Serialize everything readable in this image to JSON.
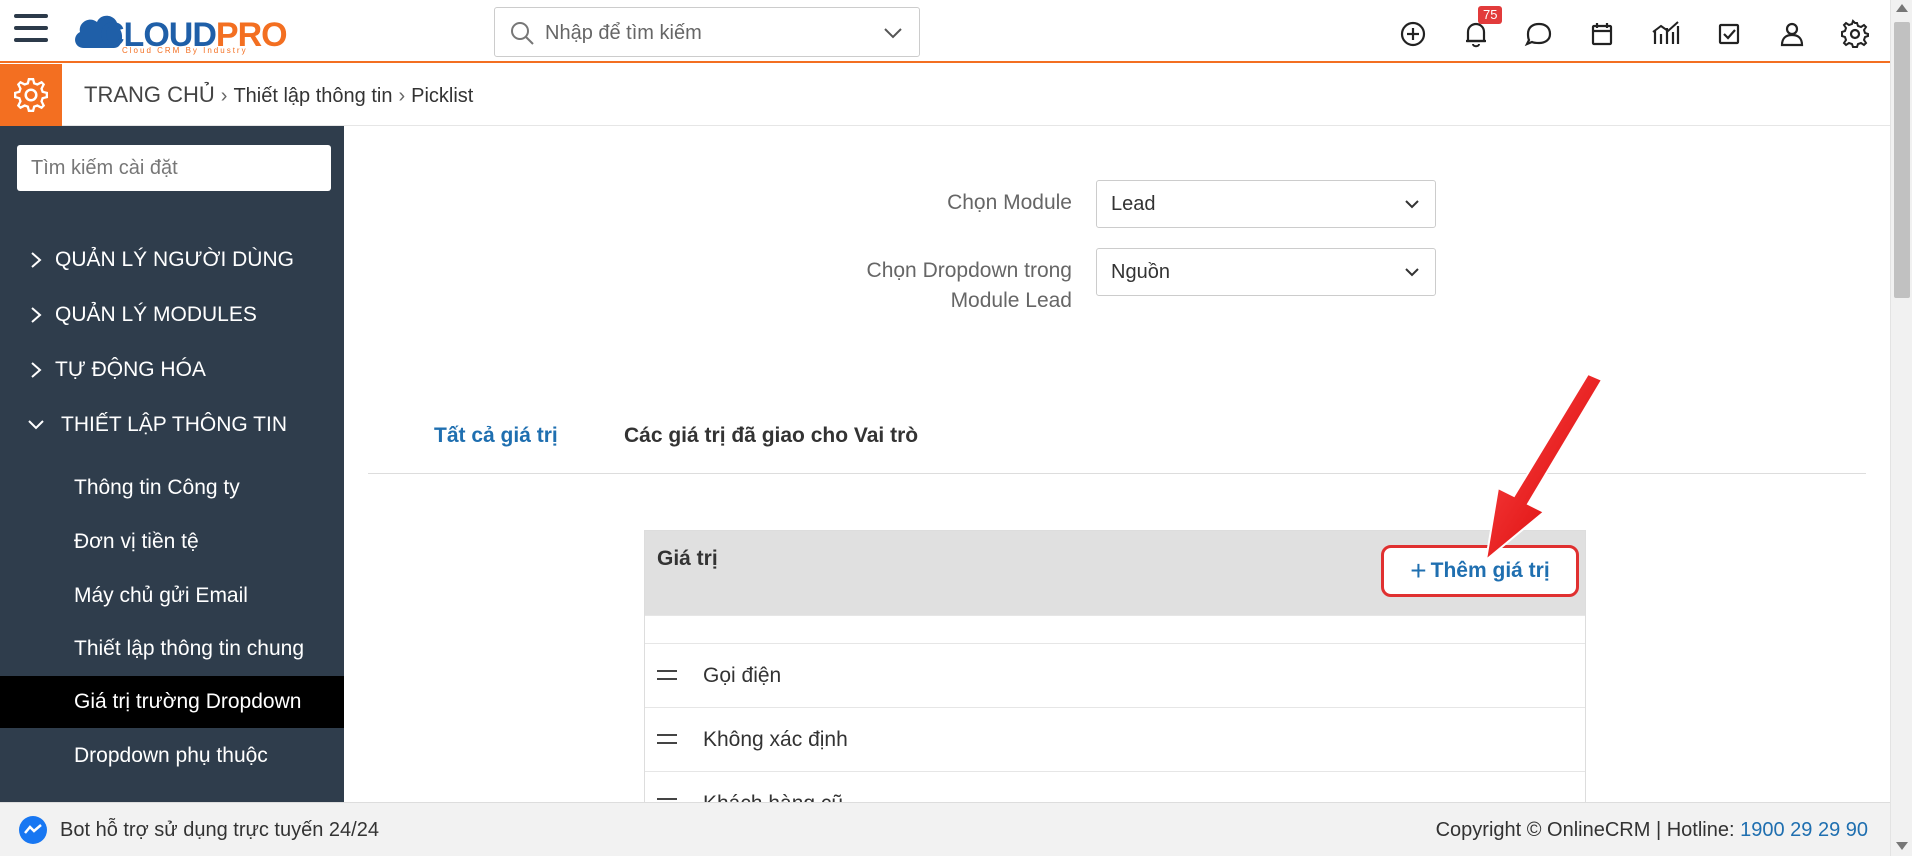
{
  "brand": {
    "logo_text_main": "CLOUD",
    "logo_text_accent": "PRO",
    "logo_tagline": "Cloud CRM By Industry",
    "accent_color": "#f36f21",
    "brand_color": "#1f5fa8"
  },
  "topbar": {
    "search_placeholder": "Nhập để tìm kiếm",
    "notification_count": "75",
    "icons": [
      "plus-circle-icon",
      "bell-icon",
      "chat-icon",
      "calendar-icon",
      "chart-icon",
      "checkbox-icon",
      "user-icon",
      "gear-icon"
    ]
  },
  "breadcrumb": {
    "home": "TRANG CHỦ",
    "level1": "Thiết lập thông tin",
    "level2": "Picklist"
  },
  "sidebar": {
    "search_placeholder": "Tìm kiếm cài đặt",
    "sections": [
      {
        "label": "QUẢN LÝ NGƯỜI DÙNG",
        "expanded": false
      },
      {
        "label": "QUẢN LÝ MODULES",
        "expanded": false
      },
      {
        "label": "TỰ ĐỘNG HÓA",
        "expanded": false
      },
      {
        "label": "THIẾT LẬP THÔNG TIN",
        "expanded": true
      }
    ],
    "subitems": [
      {
        "label": "Thông tin Công ty",
        "active": false
      },
      {
        "label": "Đơn vị tiền tệ",
        "active": false
      },
      {
        "label": "Máy chủ gửi Email",
        "active": false
      },
      {
        "label": "Thiết lập thông tin chung",
        "active": false
      },
      {
        "label": "Giá trị trường Dropdown",
        "active": true
      },
      {
        "label": "Dropdown phụ thuộc",
        "active": false
      }
    ]
  },
  "form": {
    "module_label": "Chọn Module",
    "module_value": "Lead",
    "dropdown_label_line1": "Chọn Dropdown trong",
    "dropdown_label_line2": "Module Lead",
    "dropdown_value": "Nguồn"
  },
  "tabs": [
    {
      "label": "Tất cả giá trị",
      "active": true
    },
    {
      "label": "Các giá trị đã giao cho Vai trò",
      "active": false
    }
  ],
  "table": {
    "header": "Giá trị",
    "add_button_label": "Thêm giá trị",
    "rows": [
      "Gọi điện",
      "Không xác định",
      "Khách hàng cũ"
    ]
  },
  "footer": {
    "bot_text": "Bot hỗ trợ sử dụng trực tuyến 24/24",
    "copyright": "Copyright © OnlineCRM",
    "hotline_label": "Hotline:",
    "hotline_number": "1900 29 29 90"
  }
}
